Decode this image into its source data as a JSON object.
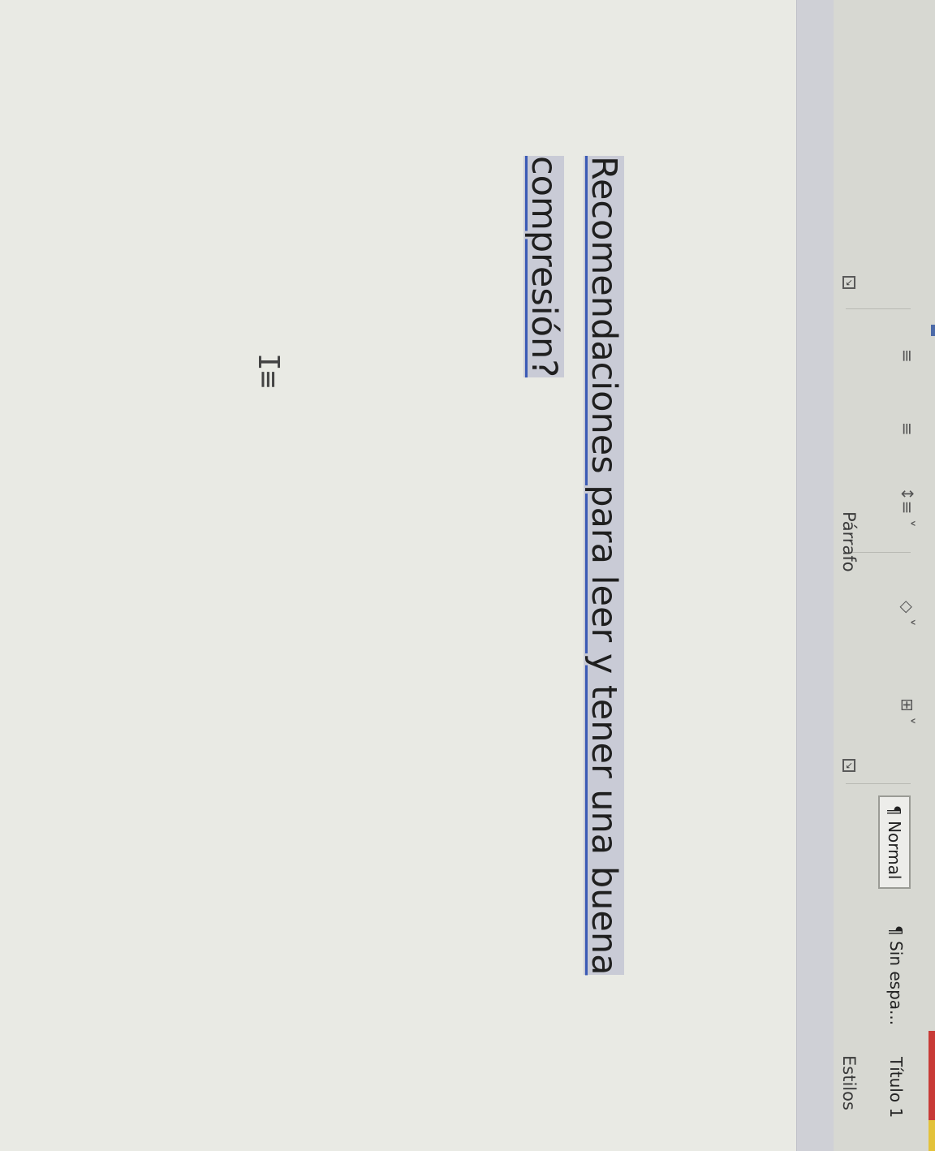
{
  "ribbon": {
    "paragraph_group_label": "Párrafo",
    "styles_group_label": "Estilos",
    "styles": [
      {
        "label": "¶ Normal",
        "selected": true
      },
      {
        "label": "¶ Sin espa..."
      },
      {
        "label": "Título 1"
      }
    ],
    "icons": [
      "line-spacing-icon",
      "shading-icon",
      "borders-icon",
      "dialog-launcher-icon"
    ]
  },
  "document": {
    "heading": "Recomendaciones para leer y tener una buena compresión?",
    "heading_lines": [
      "Recomendaciones para leer y tener una buena",
      "compresión?"
    ]
  },
  "colors": {
    "selection_highlight": "#c9cbd6",
    "heading_underline": "#3b5bb5"
  }
}
